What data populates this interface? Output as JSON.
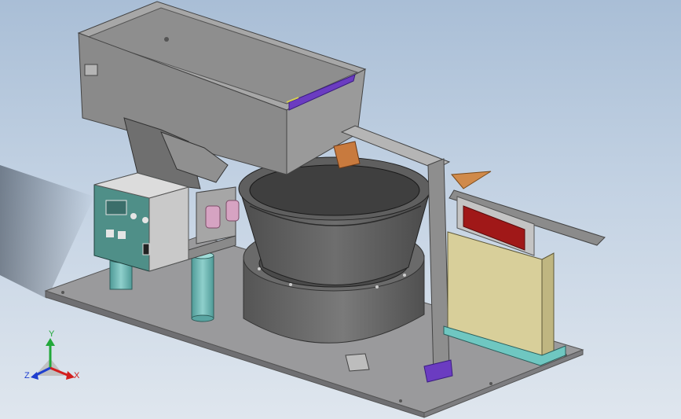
{
  "viewport": {
    "background_top": "#a9bed6",
    "background_bottom": "#dfe6ee"
  },
  "model": {
    "base_plate_color": "#8e8e90",
    "hopper_color": "#8a8a8a",
    "bowl_color": "#5a5a5a",
    "column_color": "#6fb3b0",
    "controller_color": "#4f8f88",
    "rail_color": "#8b8b8b",
    "accent_purple": "#6b3cc1",
    "accent_orange": "#c87a3e",
    "sensor_red": "#a01818",
    "hopper_base_color": "#d8cf9a"
  },
  "triad": {
    "y_label": "Y",
    "x_label": "X",
    "z_label": "Z",
    "x_color": "#d21e1e",
    "y_color": "#22a83a",
    "z_color": "#1f3fcf"
  }
}
